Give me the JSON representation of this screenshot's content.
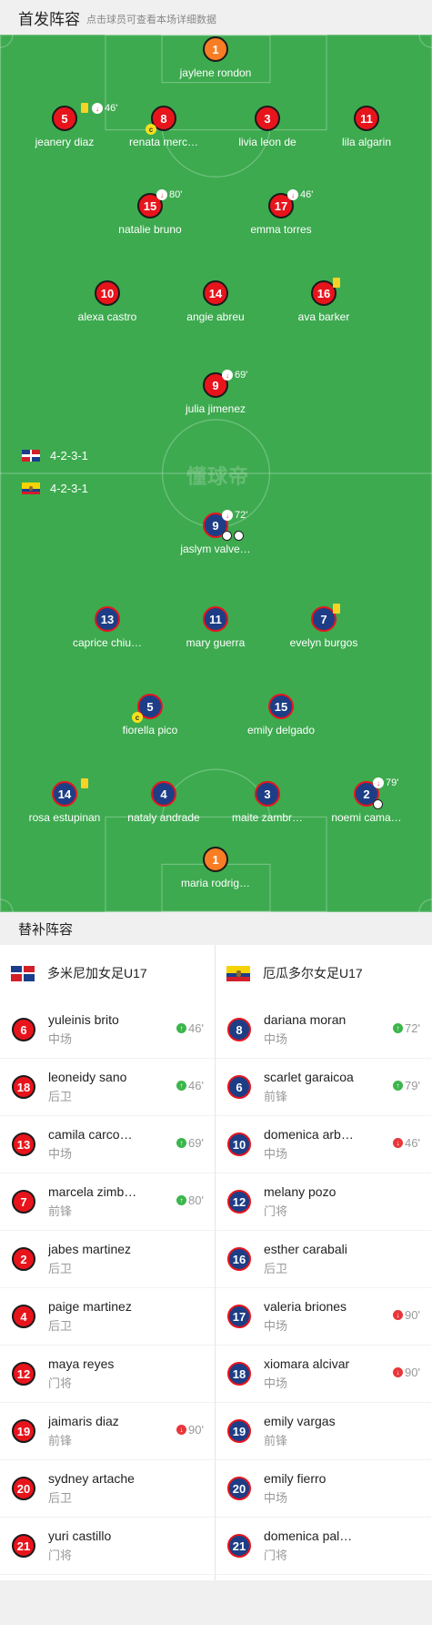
{
  "header": {
    "title": "首发阵容",
    "subtitle": "点击球员可查看本场详细数据"
  },
  "watermark": "懂球帝",
  "formations": [
    {
      "team": "dominican",
      "flag": "dominican-republic-flag",
      "text": "4-2-3-1"
    },
    {
      "team": "ecuador",
      "flag": "ecuador-flag",
      "text": "4-2-3-1"
    }
  ],
  "home_lineup": [
    {
      "num": "1",
      "name": "jaylene rondon",
      "color": "orange"
    },
    {
      "num": "5",
      "name": "jeanery diaz",
      "color": "red",
      "yellow": true,
      "sub_out": "46'"
    },
    {
      "num": "8",
      "name": "renata merc…",
      "color": "red",
      "captain": "c"
    },
    {
      "num": "3",
      "name": "livia leon de",
      "color": "red"
    },
    {
      "num": "11",
      "name": "lila algarin",
      "color": "red"
    },
    {
      "num": "15",
      "name": "natalie bruno",
      "color": "red",
      "sub_out": "80'"
    },
    {
      "num": "17",
      "name": "emma torres",
      "color": "red",
      "sub_out": "46'"
    },
    {
      "num": "10",
      "name": "alexa castro",
      "color": "red"
    },
    {
      "num": "14",
      "name": "angie abreu",
      "color": "red"
    },
    {
      "num": "16",
      "name": "ava barker",
      "color": "red",
      "yellow": true
    },
    {
      "num": "9",
      "name": "julia jimenez",
      "color": "red",
      "sub_out": "69'"
    }
  ],
  "away_lineup": [
    {
      "num": "9",
      "name": "jaslym valve…",
      "color": "blue",
      "sub_out": "72'",
      "goals": 2
    },
    {
      "num": "13",
      "name": "caprice chiu…",
      "color": "blue"
    },
    {
      "num": "11",
      "name": "mary guerra",
      "color": "blue"
    },
    {
      "num": "7",
      "name": "evelyn burgos",
      "color": "blue",
      "yellow": true
    },
    {
      "num": "5",
      "name": "fiorella pico",
      "color": "blue",
      "captain": "c"
    },
    {
      "num": "15",
      "name": "emily delgado",
      "color": "blue"
    },
    {
      "num": "14",
      "name": "rosa estupinan",
      "color": "blue",
      "yellow": true
    },
    {
      "num": "4",
      "name": "nataly andrade",
      "color": "blue"
    },
    {
      "num": "3",
      "name": "maite zambr…",
      "color": "blue"
    },
    {
      "num": "2",
      "name": "noemi cama…",
      "color": "blue",
      "sub_out": "79'",
      "own_goal": true
    },
    {
      "num": "1",
      "name": "maria rodrig…",
      "color": "orange"
    }
  ],
  "subs_title": "替补阵容",
  "bench": {
    "home": {
      "team_name": "多米尼加女足U17",
      "players": [
        {
          "num": "6",
          "name": "yuleinis brito",
          "pos": "中场",
          "event": "in",
          "time": "46'"
        },
        {
          "num": "18",
          "name": "leoneidy sano",
          "pos": "后卫",
          "event": "in",
          "time": "46'"
        },
        {
          "num": "13",
          "name": "camila carco…",
          "pos": "中场",
          "event": "in",
          "time": "69'"
        },
        {
          "num": "7",
          "name": "marcela zimb…",
          "pos": "前锋",
          "event": "in",
          "time": "80'"
        },
        {
          "num": "2",
          "name": "jabes martinez",
          "pos": "后卫"
        },
        {
          "num": "4",
          "name": "paige martinez",
          "pos": "后卫"
        },
        {
          "num": "12",
          "name": "maya reyes",
          "pos": "门将"
        },
        {
          "num": "19",
          "name": "jaimaris diaz",
          "pos": "前锋",
          "event": "out",
          "time": "90'"
        },
        {
          "num": "20",
          "name": "sydney artache",
          "pos": "后卫"
        },
        {
          "num": "21",
          "name": "yuri castillo",
          "pos": "门将"
        }
      ]
    },
    "away": {
      "team_name": "厄瓜多尔女足U17",
      "players": [
        {
          "num": "8",
          "name": "dariana moran",
          "pos": "中场",
          "event": "in",
          "time": "72'"
        },
        {
          "num": "6",
          "name": "scarlet garaicoa",
          "pos": "前锋",
          "event": "in",
          "time": "79'"
        },
        {
          "num": "10",
          "name": "domenica arb…",
          "pos": "中场",
          "event": "out",
          "time": "46'"
        },
        {
          "num": "12",
          "name": "melany pozo",
          "pos": "门将"
        },
        {
          "num": "16",
          "name": "esther carabali",
          "pos": "后卫"
        },
        {
          "num": "17",
          "name": "valeria briones",
          "pos": "中场",
          "event": "out",
          "time": "90'"
        },
        {
          "num": "18",
          "name": "xiomara alcivar",
          "pos": "中场",
          "event": "out",
          "time": "90'"
        },
        {
          "num": "19",
          "name": "emily vargas",
          "pos": "前锋"
        },
        {
          "num": "20",
          "name": "emily fierro",
          "pos": "中场"
        },
        {
          "num": "21",
          "name": "domenica pal…",
          "pos": "门将"
        }
      ]
    }
  }
}
